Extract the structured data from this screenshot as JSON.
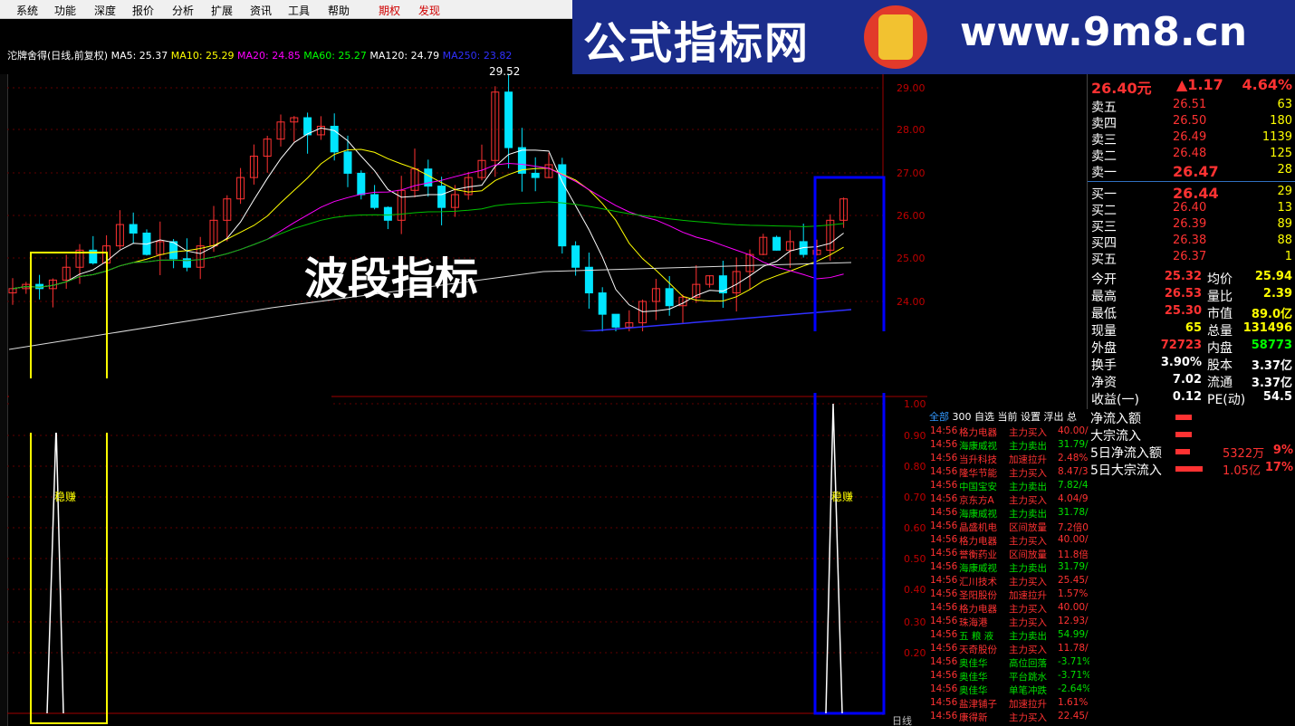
{
  "menu": {
    "items": [
      "系统",
      "功能",
      "深度",
      "报价",
      "分析",
      "扩展",
      "资讯",
      "工具",
      "帮助"
    ],
    "special": [
      "期权",
      "发现"
    ]
  },
  "banner": {
    "title": "公式指标网",
    "url": "www.9m8.cn"
  },
  "stock": {
    "title": "沱牌舍得(日线,前复权)",
    "ma": [
      {
        "label": "MA5: 25.37",
        "color": "#ffffff"
      },
      {
        "label": "MA10: 25.29",
        "color": "#ffff00"
      },
      {
        "label": "MA20: 24.85",
        "color": "#ff00ff"
      },
      {
        "label": "MA60: 25.27",
        "color": "#00ff00"
      },
      {
        "label": "MA120: 24.79",
        "color": "#ffffff"
      },
      {
        "label": "MA250: 23.82",
        "color": "#3030ff"
      }
    ],
    "high_marker": "29.52"
  },
  "overlay": {
    "title": "波段指标"
  },
  "upper_axis": [
    "29.00",
    "28.00",
    "27.00",
    "26.00",
    "25.00",
    "24.00"
  ],
  "lower_axis": [
    "1.00",
    "0.90",
    "0.80",
    "0.70",
    "0.60",
    "0.50",
    "0.40",
    "0.30",
    "0.20"
  ],
  "signal_label": "稳赚",
  "lower_period": "日线",
  "quote": {
    "price": "26.40元",
    "change": "▲1.17",
    "pct": "4.64%",
    "sells": [
      {
        "name": "卖五",
        "price": "26.51",
        "vol": "63"
      },
      {
        "name": "卖四",
        "price": "26.50",
        "vol": "180"
      },
      {
        "name": "卖三",
        "price": "26.49",
        "vol": "1139"
      },
      {
        "name": "卖二",
        "price": "26.48",
        "vol": "125"
      },
      {
        "name": "卖一",
        "price": "26.47",
        "vol": "28"
      }
    ],
    "buys": [
      {
        "name": "买一",
        "price": "26.44",
        "vol": "29"
      },
      {
        "name": "买二",
        "price": "26.40",
        "vol": "13"
      },
      {
        "name": "买三",
        "price": "26.39",
        "vol": "89"
      },
      {
        "name": "买四",
        "price": "26.38",
        "vol": "88"
      },
      {
        "name": "买五",
        "price": "26.37",
        "vol": "1"
      }
    ],
    "stats": [
      [
        "今开",
        "25.32",
        "均价",
        "25.94"
      ],
      [
        "最高",
        "26.53",
        "量比",
        "2.39"
      ],
      [
        "最低",
        "25.30",
        "市值",
        "89.0亿"
      ],
      [
        "现量",
        "65",
        "总量",
        "131496"
      ],
      [
        "外盘",
        "72723",
        "内盘",
        "58773"
      ],
      [
        "换手",
        "3.90%",
        "股本",
        "3.37亿"
      ],
      [
        "净资",
        "7.02",
        "流通",
        "3.37亿"
      ],
      [
        "收益(一)",
        "0.12",
        "PE(动)",
        "54.5"
      ]
    ],
    "flows": [
      {
        "label": "净流入额",
        "value": "",
        "pct": ""
      },
      {
        "label": "大宗流入",
        "value": "",
        "pct": ""
      },
      {
        "label": "5日净流入额",
        "value": "5322万",
        "pct": "9%"
      },
      {
        "label": "5日大宗流入",
        "value": "1.05亿",
        "pct": "17%"
      }
    ]
  },
  "flow_tabs": [
    "全部",
    "300",
    "自选",
    "当前",
    "设置",
    "浮出",
    "总"
  ],
  "flow_rows": [
    {
      "t": "14:56",
      "name": "格力电器",
      "act": "主力买入",
      "val": "40.00/",
      "c": "red"
    },
    {
      "t": "14:56",
      "name": "海康威视",
      "act": "主力卖出",
      "val": "31.79/",
      "c": "green"
    },
    {
      "t": "14:56",
      "name": "当升科技",
      "act": "加速拉升",
      "val": "2.48%",
      "c": "red"
    },
    {
      "t": "14:56",
      "name": "隆华节能",
      "act": "主力买入",
      "val": "8.47/3",
      "c": "red"
    },
    {
      "t": "14:56",
      "name": "中国宝安",
      "act": "主力卖出",
      "val": "7.82/4",
      "c": "green"
    },
    {
      "t": "14:56",
      "name": "京东方A",
      "act": "主力买入",
      "val": "4.04/9",
      "c": "red"
    },
    {
      "t": "14:56",
      "name": "海康威视",
      "act": "主力卖出",
      "val": "31.78/",
      "c": "green"
    },
    {
      "t": "14:56",
      "name": "晶盛机电",
      "act": "区间放量",
      "val": "7.2倍0",
      "c": "red"
    },
    {
      "t": "14:56",
      "name": "格力电器",
      "act": "主力买入",
      "val": "40.00/",
      "c": "red"
    },
    {
      "t": "14:56",
      "name": "誉衡药业",
      "act": "区间放量",
      "val": "11.8倍",
      "c": "red"
    },
    {
      "t": "14:56",
      "name": "海康威视",
      "act": "主力卖出",
      "val": "31.79/",
      "c": "green"
    },
    {
      "t": "14:56",
      "name": "汇川技术",
      "act": "主力买入",
      "val": "25.45/",
      "c": "red"
    },
    {
      "t": "14:56",
      "name": "圣阳股份",
      "act": "加速拉升",
      "val": "1.57%",
      "c": "red"
    },
    {
      "t": "14:56",
      "name": "格力电器",
      "act": "主力买入",
      "val": "40.00/",
      "c": "red"
    },
    {
      "t": "14:56",
      "name": "珠海港",
      "act": "主力买入",
      "val": "12.93/",
      "c": "red"
    },
    {
      "t": "14:56",
      "name": "五 粮 液",
      "act": "主力卖出",
      "val": "54.99/",
      "c": "green"
    },
    {
      "t": "14:56",
      "name": "天奇股份",
      "act": "主力买入",
      "val": "11.78/",
      "c": "red"
    },
    {
      "t": "14:56",
      "name": "奥佳华",
      "act": "高位回落",
      "val": "-3.71%",
      "c": "green"
    },
    {
      "t": "14:56",
      "name": "奥佳华",
      "act": "平台跳水",
      "val": "-3.71%",
      "c": "green"
    },
    {
      "t": "14:56",
      "name": "奥佳华",
      "act": "单笔冲跌",
      "val": "-2.64%",
      "c": "green"
    },
    {
      "t": "14:56",
      "name": "盐津铺子",
      "act": "加速拉升",
      "val": "1.61%",
      "c": "red"
    },
    {
      "t": "14:56",
      "name": "康得新",
      "act": "主力买入",
      "val": "22.45/",
      "c": "red"
    }
  ]
}
